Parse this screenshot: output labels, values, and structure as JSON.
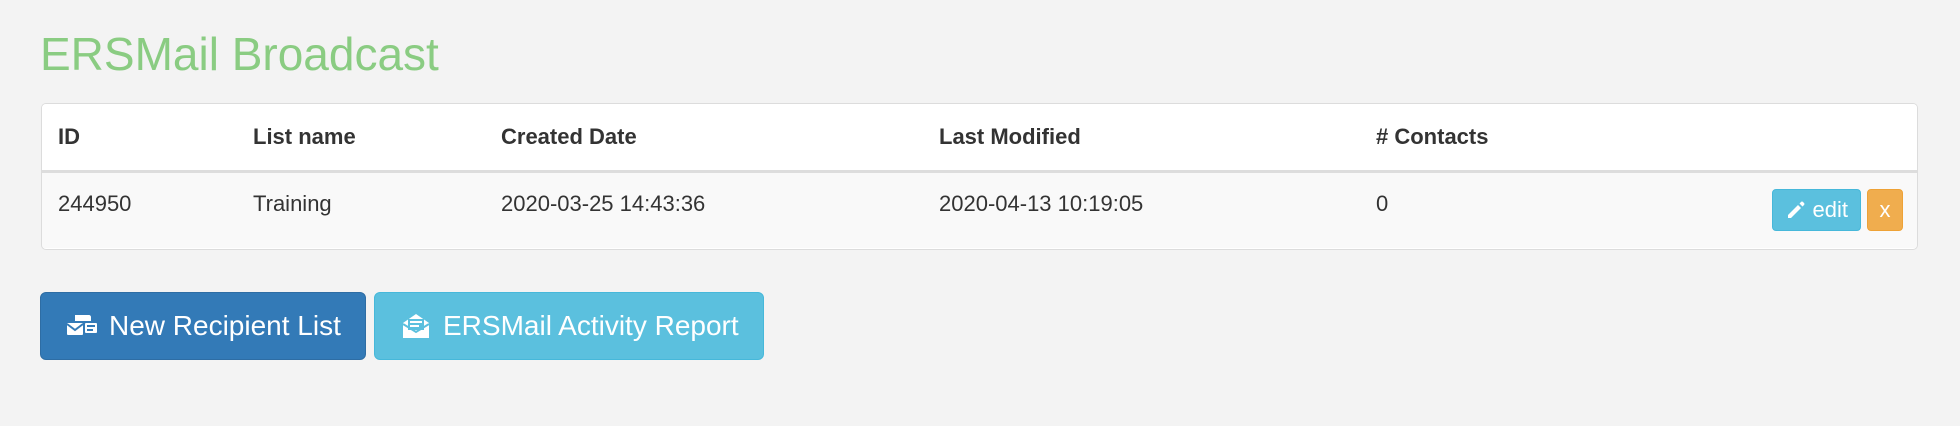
{
  "page": {
    "title": "ERSMail Broadcast"
  },
  "table": {
    "headers": {
      "id": "ID",
      "list_name": "List name",
      "created": "Created Date",
      "modified": "Last Modified",
      "contacts": "# Contacts"
    },
    "rows": [
      {
        "id": "244950",
        "list_name": "Training",
        "created": "2020-03-25 14:43:36",
        "modified": "2020-04-13 10:19:05",
        "contacts": "0",
        "edit_label": "edit",
        "delete_label": "x"
      }
    ]
  },
  "actions": {
    "new_list_label": "New Recipient List",
    "report_label": "ERSMail Activity Report"
  },
  "icons": {
    "edit": "pencil-icon",
    "new_list": "mail-list-icon",
    "report": "envelope-open-icon"
  },
  "colors": {
    "title": "#8acc82",
    "primary": "#337ab7",
    "info": "#5bc0de",
    "warning": "#f0ad4e",
    "background": "#f3f3f3"
  }
}
